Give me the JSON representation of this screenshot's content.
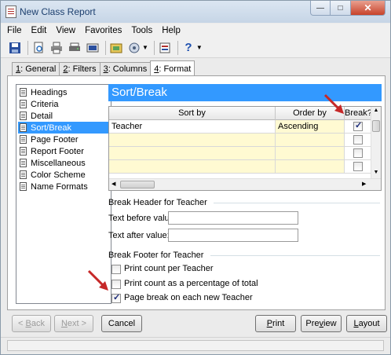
{
  "window": {
    "title": "New Class Report"
  },
  "menu": [
    "File",
    "Edit",
    "View",
    "Favorites",
    "Tools",
    "Help"
  ],
  "toolbar": {
    "icons": [
      "save-icon",
      "preview-icon",
      "print-icon",
      "print-setup-icon",
      "export-icon",
      "open-icon",
      "layout-icon",
      "settings-icon",
      "help-icon"
    ]
  },
  "tabs": [
    {
      "key": "1",
      "label": ": General"
    },
    {
      "key": "2",
      "label": ": Filters"
    },
    {
      "key": "3",
      "label": ": Columns"
    },
    {
      "key": "4",
      "label": ": Format"
    }
  ],
  "sidebar": {
    "items": [
      "Headings",
      "Criteria",
      "Detail",
      "Sort/Break",
      "Page Footer",
      "Report Footer",
      "Miscellaneous",
      "Color Scheme",
      "Name Formats"
    ],
    "selected_index": 3
  },
  "section": {
    "title": "Sort/Break"
  },
  "grid": {
    "headers": {
      "sort_by": "Sort by",
      "order_by": "Order by",
      "break": "Break?"
    },
    "rows": [
      {
        "sort_by": "Teacher",
        "order_by": "Ascending",
        "break": true
      },
      {
        "sort_by": "",
        "order_by": "",
        "break": false
      },
      {
        "sort_by": "",
        "order_by": "",
        "break": false
      },
      {
        "sort_by": "",
        "order_by": "",
        "break": false
      }
    ]
  },
  "break_header": {
    "title": "Break Header for Teacher",
    "text_before_label": "Text before value:",
    "text_before_value": "",
    "text_after_label": "Text after value:",
    "text_after_value": ""
  },
  "break_footer": {
    "title": "Break Footer for Teacher",
    "options": [
      {
        "label": "Print count per Teacher",
        "checked": false
      },
      {
        "label": "Print count as a percentage of total",
        "checked": false
      },
      {
        "label": "Page break on each new Teacher",
        "checked": true
      }
    ]
  },
  "buttons": {
    "back_key": "B",
    "back_rest": "ack",
    "next_key": "N",
    "next_rest": "ext >",
    "cancel": "Cancel",
    "print_key": "P",
    "print_rest": "rint",
    "preview_key": "v",
    "preview_a": "Pre",
    "preview_b": "iew",
    "layout_key": "L",
    "layout_rest": "ayout"
  },
  "colors": {
    "accent": "#3399ff",
    "arrow": "#c62828",
    "grid_yellow": "#fffad2"
  }
}
